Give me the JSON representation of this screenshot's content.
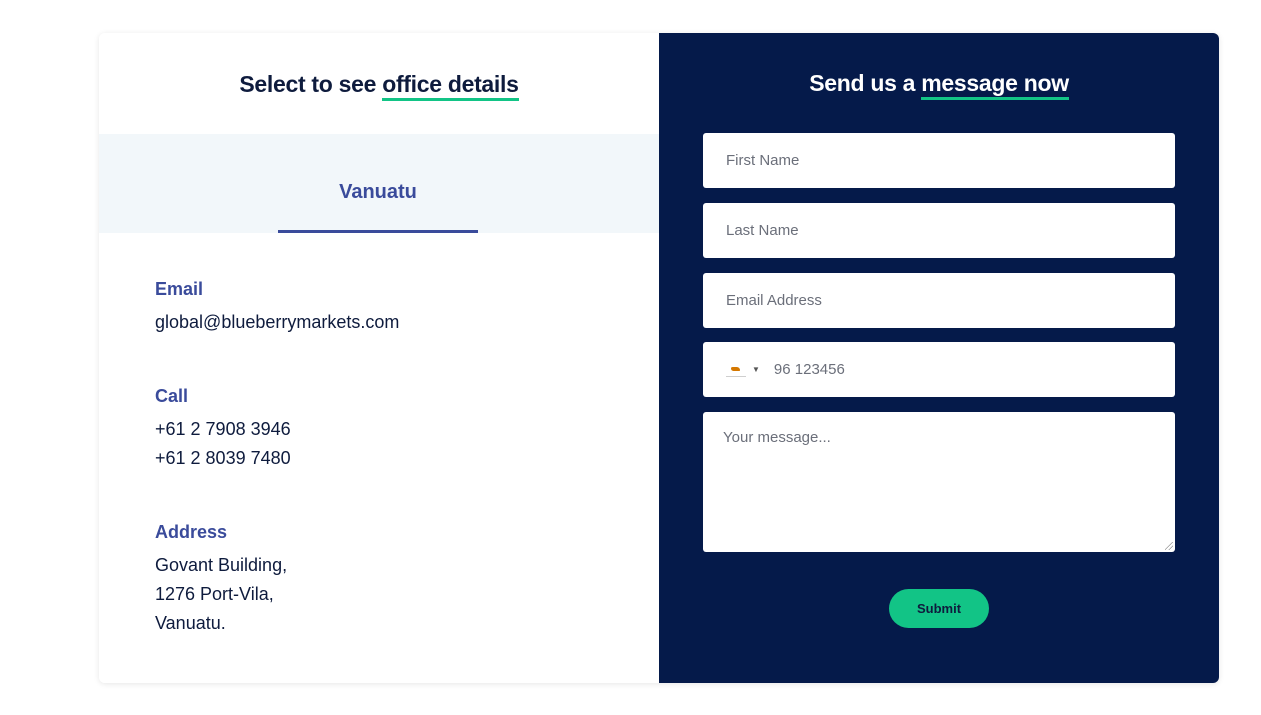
{
  "left_panel": {
    "heading_prefix": "Select to see ",
    "heading_highlight": "office details",
    "tab_label": "Vanuatu",
    "email": {
      "label": "Email",
      "value": "global@blueberrymarkets.com"
    },
    "call": {
      "label": "Call",
      "lines": [
        "+61 2 7908 3946",
        "+61 2 8039 7480"
      ]
    },
    "address": {
      "label": "Address",
      "lines": [
        "Govant Building,",
        "1276 Port-Vila,",
        "Vanuatu."
      ]
    }
  },
  "right_panel": {
    "heading_prefix": "Send us a ",
    "heading_highlight": "message now",
    "first_name_placeholder": "First Name",
    "last_name_placeholder": "Last Name",
    "email_placeholder": "Email Address",
    "phone_placeholder": "96 123456",
    "phone_flag_icon": "cyprus-flag-icon",
    "message_placeholder": "Your message...",
    "submit_label": "Submit"
  },
  "colors": {
    "navy": "#051a4a",
    "accent_green": "#12c486",
    "label_blue": "#3a4b9b",
    "tab_band": "#f2f7fa"
  }
}
